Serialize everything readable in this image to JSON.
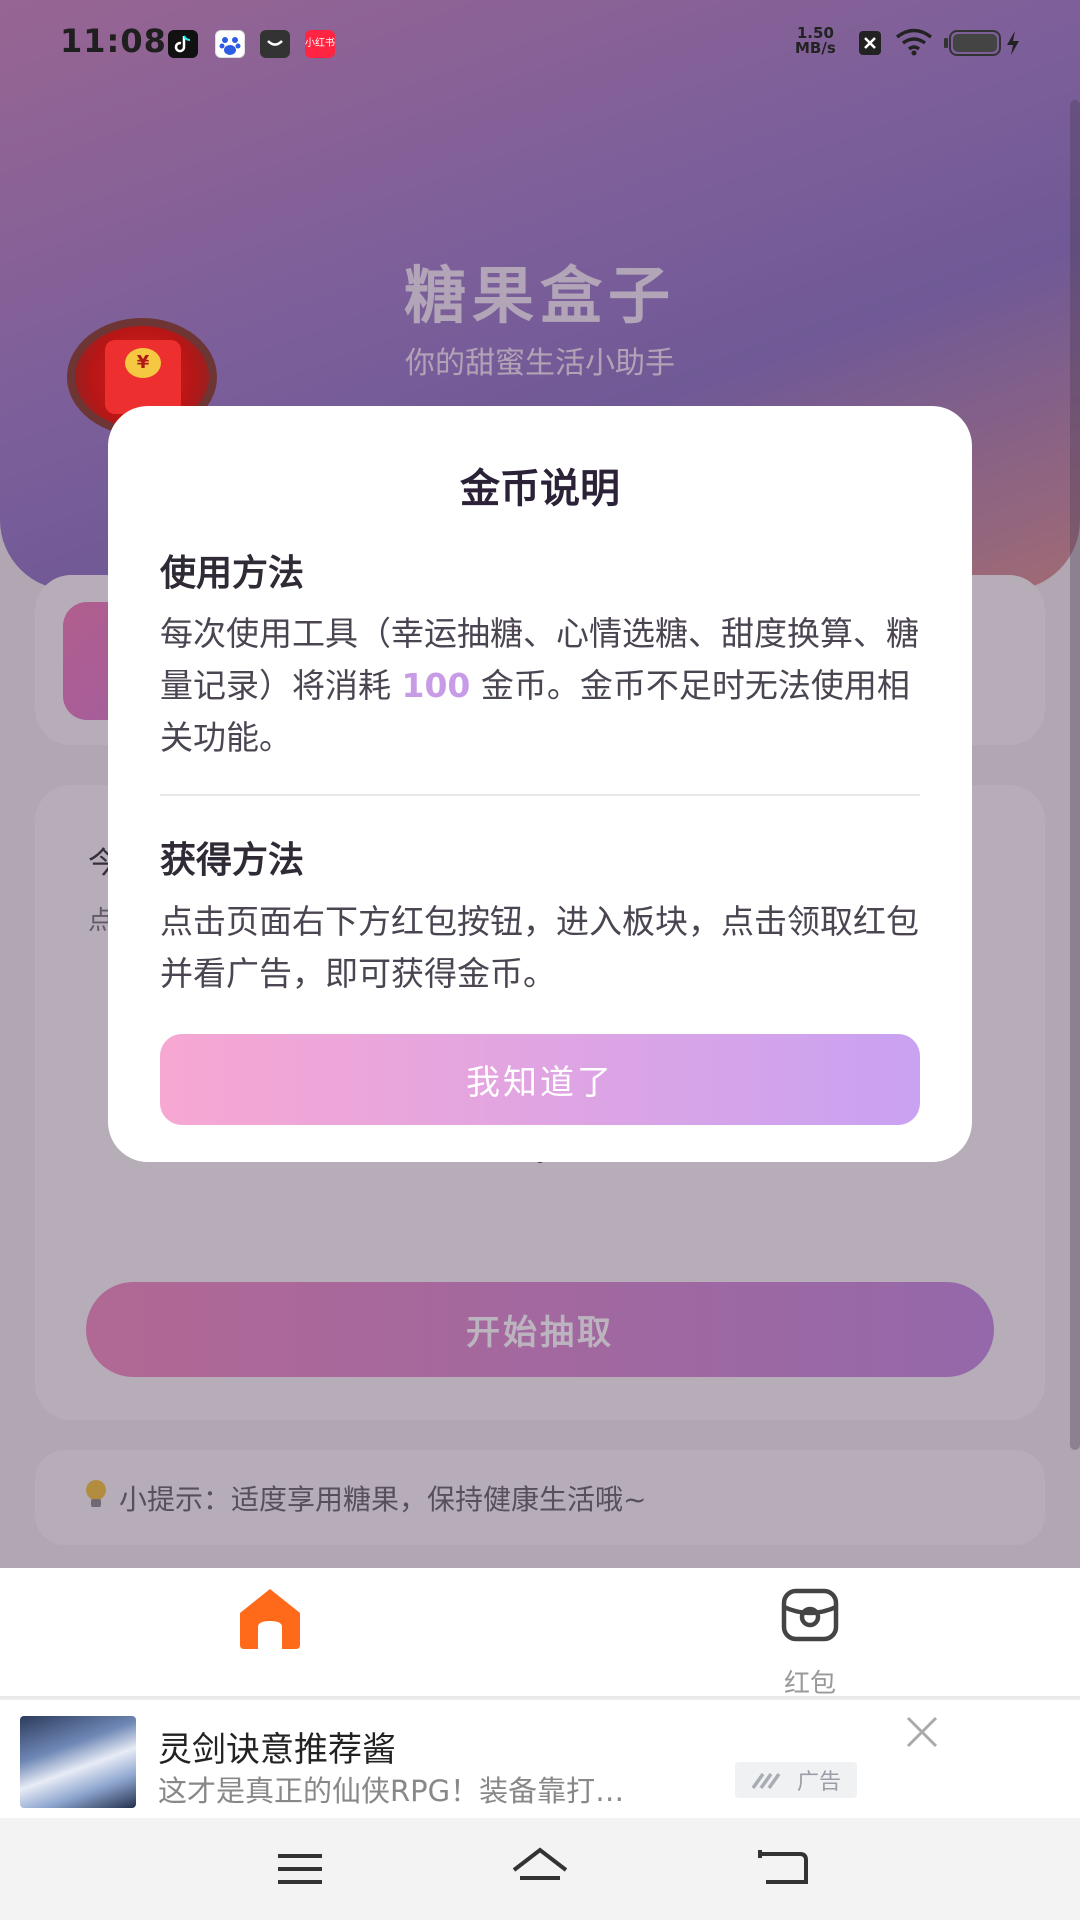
{
  "status_bar": {
    "time": "11:08",
    "net_speed_value": "1.50",
    "net_speed_unit": "MB/s",
    "notification_icons": [
      "tiktok-icon",
      "baidu-icon",
      "mail-icon",
      "xiaohongshu-icon"
    ],
    "xiaohongshu_label": "小红书"
  },
  "app": {
    "title": "糖果盒子",
    "subtitle": "你的甜蜜生活小助手",
    "card_text_1": "今",
    "card_text_2": "点",
    "start_button_label": "开始抽取",
    "tip_icon": "lightbulb-icon",
    "tip_text": "小提示：适度享用糖果，保持健康生活哦~"
  },
  "floating_red_packet": {
    "icon": "red-envelope-icon",
    "symbol": "¥"
  },
  "dialog": {
    "title": "金币说明",
    "usage_title": "使用方法",
    "usage_text_before": "每次使用工具（幸运抽糖、心情选糖、甜度换算、糖量记录）将消耗",
    "usage_cost": "100",
    "usage_text_after": "金币。金币不足时无法使用相关功能。",
    "earn_title": "获得方法",
    "earn_text": "点击页面右下方红包按钮，进入板块，点击领取红包并看广告，即可获得金币。",
    "confirm_label": "我知道了"
  },
  "bottom_nav": {
    "items": [
      {
        "label": "",
        "icon": "home-icon",
        "active": true
      },
      {
        "label": "红包",
        "icon": "red-packet-icon",
        "active": false
      }
    ],
    "active_color": "#ff6a1a"
  },
  "ad": {
    "title": "灵剑诀意推荐酱",
    "description": "这才是真正的仙侠RPG！装备靠打…",
    "badge": "广告",
    "close_icon": "close-icon"
  },
  "system_nav": {
    "buttons": [
      "menu-icon",
      "home-outline-icon",
      "back-icon"
    ]
  },
  "colors": {
    "accent_purple": "#c79be6",
    "button_gradient_start": "#f7a7d2",
    "button_gradient_end": "#c9a2f2"
  }
}
